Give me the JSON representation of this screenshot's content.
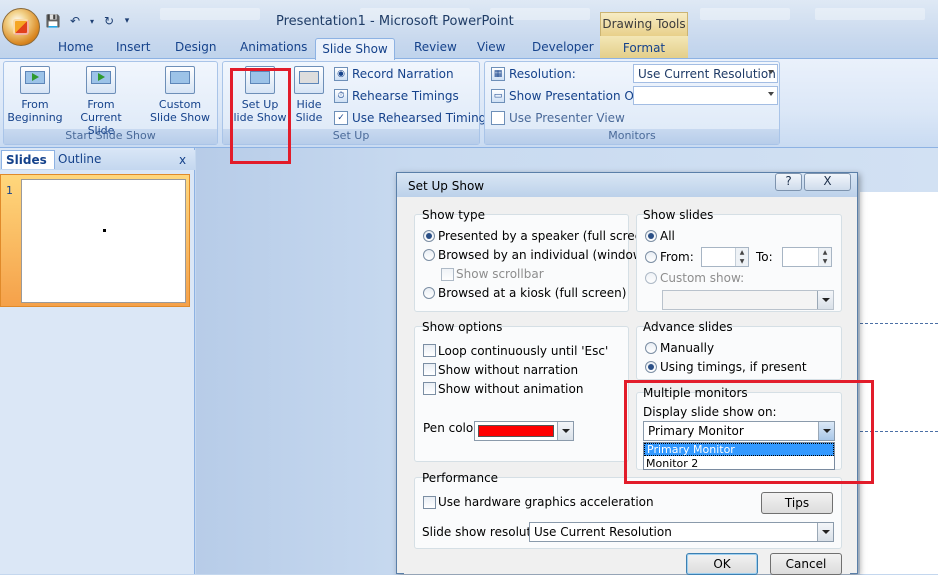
{
  "window": {
    "title": "Presentation1 - Microsoft PowerPoint",
    "context_tab_header": "Drawing Tools"
  },
  "tabs": [
    "Home",
    "Insert",
    "Design",
    "Animations",
    "Slide Show",
    "Review",
    "View",
    "Developer",
    "Format"
  ],
  "active_tab": "Slide Show",
  "ribbon": {
    "start": {
      "label": "Start Slide Show",
      "from_beginning": "From\nBeginning",
      "from_current": "From\nCurrent Slide",
      "custom": "Custom\nSlide Show"
    },
    "setup": {
      "label": "Set Up",
      "setup_show": "Set Up\nlide Show",
      "hide_slide": "Hide\nSlide",
      "record": "Record Narration",
      "rehearse": "Rehearse Timings",
      "use_rehearsed": "Use Rehearsed Timings"
    },
    "monitors": {
      "label": "Monitors",
      "resolution_label": "Resolution:",
      "resolution_value": "Use Current Resolution",
      "show_on_label": "Show Presentation On:",
      "show_on_value": "",
      "presenter_view": "Use Presenter View"
    }
  },
  "left_pane": {
    "tab_slides": "Slides",
    "tab_outline": "Outline",
    "close": "x",
    "slide_number": "1"
  },
  "dialog": {
    "title": "Set Up Show",
    "help": "?",
    "close": "X",
    "show_type": {
      "title": "Show type",
      "speaker": "Presented by a speaker (full screen)",
      "individual": "Browsed by an individual (window)",
      "scrollbar": "Show scrollbar",
      "kiosk": "Browsed at a kiosk (full screen)"
    },
    "show_slides": {
      "title": "Show slides",
      "all": "All",
      "from": "From:",
      "to": "To:",
      "custom": "Custom show:"
    },
    "show_options": {
      "title": "Show options",
      "loop": "Loop continuously until 'Esc'",
      "no_narration": "Show without narration",
      "no_animation": "Show without animation",
      "pen_color": "Pen color:",
      "pen_color_value": "#ff0000"
    },
    "advance": {
      "title": "Advance slides",
      "manually": "Manually",
      "timings": "Using timings, if present"
    },
    "monitors": {
      "title": "Multiple monitors",
      "display_on": "Display slide show on:",
      "selected": "Primary Monitor",
      "options": [
        "Primary Monitor",
        "Monitor 2"
      ]
    },
    "performance": {
      "title": "Performance",
      "hw_accel": "Use hardware graphics acceleration",
      "tips": "Tips",
      "resolution_label": "Slide show resolution:",
      "resolution_value": "Use Current Resolution"
    },
    "ok": "OK",
    "cancel": "Cancel"
  },
  "colors": {
    "highlight": "#e21c2a",
    "list_selection": "#3399ff"
  }
}
